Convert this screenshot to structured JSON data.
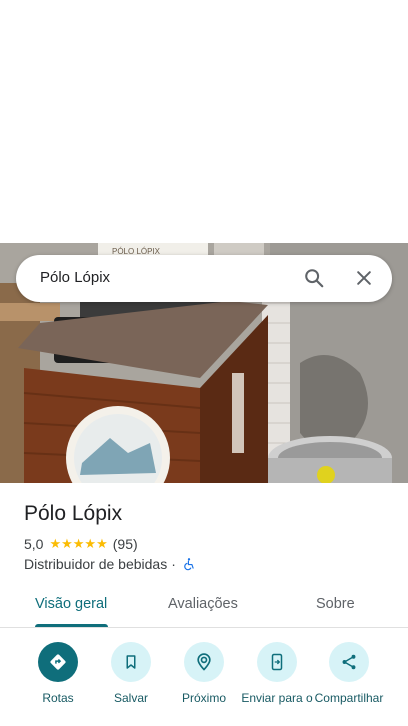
{
  "search": {
    "query": "Pólo Lópix"
  },
  "photo": {
    "sign_text": "PÓLO LÓPIX"
  },
  "place": {
    "title": "Pólo Lópix",
    "rating": "5,0",
    "stars": "★★★★★",
    "review_count": "(95)",
    "category": "Distribuidor de bebidas",
    "separator": "·"
  },
  "tabs": [
    {
      "label": "Visão geral",
      "active": true
    },
    {
      "label": "Avaliações",
      "active": false
    },
    {
      "label": "Sobre",
      "active": false
    }
  ],
  "actions": [
    {
      "label": "Rotas",
      "icon": "directions-icon"
    },
    {
      "label": "Salvar",
      "icon": "bookmark-icon"
    },
    {
      "label": "Próximo",
      "icon": "nearby-icon"
    },
    {
      "label": "Enviar para o",
      "icon": "send-to-phone-icon"
    },
    {
      "label": "Compartilhar",
      "icon": "share-icon"
    }
  ],
  "colors": {
    "accent": "#0f6e7b",
    "accent_light": "#d7f3f7",
    "star": "#fbbc04"
  }
}
